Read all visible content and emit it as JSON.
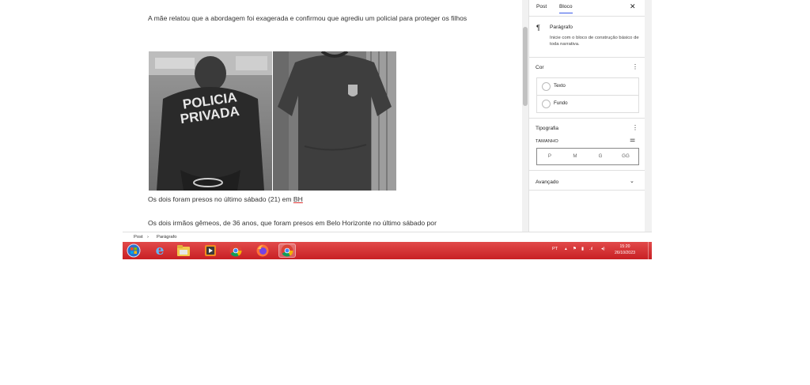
{
  "editor": {
    "paragraph1": "A mãe relatou que a abordagem foi exagerada e confirmou que agrediu um policial para proteger os filhos",
    "image_left_text_line1": "POLICIA",
    "image_left_text_line2": "PRIVADA",
    "caption_main": "Os dois foram presos no último sábado (21) em ",
    "caption_link": "BH",
    "paragraph2": "Os dois irmãos gêmeos, de 36 anos, que foram presos em Belo Horizonte no último sábado por"
  },
  "sidebar": {
    "tab_post": "Post",
    "tab_block": "Bloco",
    "close_icon": "close-icon",
    "block_icon": "paragraph-icon",
    "block_name": "Parágrafo",
    "block_description": "Inicie com o bloco de construção básico de toda narrativa.",
    "color_title": "Cor",
    "color_text": "Texto",
    "color_background": "Fundo",
    "typography_title": "Tipografia",
    "size_label": "TAMANHO",
    "sizes": [
      "P",
      "M",
      "G",
      "GG"
    ],
    "advanced_title": "Avançado"
  },
  "breadcrumb": {
    "root": "Post",
    "separator": "›",
    "current": "Parágrafo"
  },
  "taskbar": {
    "language": "PT",
    "time": "15:20",
    "date": "26/10/2023",
    "apps": [
      "start-orb",
      "internet-explorer",
      "file-explorer",
      "media-player",
      "chrome",
      "firefox",
      "chrome-canary"
    ]
  },
  "colors": {
    "accent": "#3858e9",
    "taskbar": "#d12e30"
  }
}
